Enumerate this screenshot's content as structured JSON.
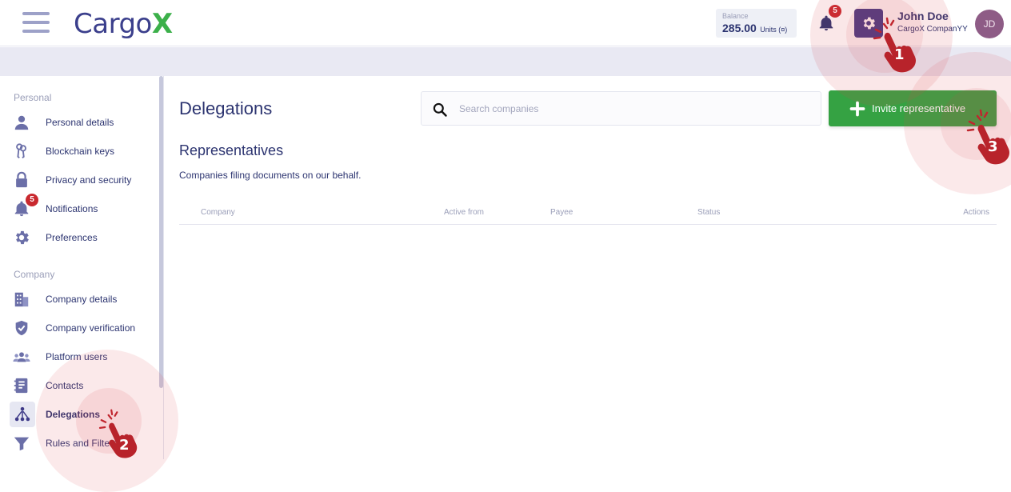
{
  "header": {
    "logo_main": "Cargo",
    "logo_x": "X",
    "balance_label": "Balance",
    "balance_value": "285.00",
    "balance_units": "Units (¤)",
    "notification_count": "5",
    "user_name": "John Doe",
    "user_company": "CargoX CompanYY",
    "avatar_initials": "JD"
  },
  "sidebar": {
    "personal_title": "Personal",
    "personal_items": [
      {
        "label": "Personal details",
        "icon": "person-icon"
      },
      {
        "label": "Blockchain keys",
        "icon": "keys-icon"
      },
      {
        "label": "Privacy and security",
        "icon": "lock-icon"
      },
      {
        "label": "Notifications",
        "icon": "bell-icon",
        "badge": "5"
      },
      {
        "label": "Preferences",
        "icon": "gear-icon"
      }
    ],
    "company_title": "Company",
    "company_items": [
      {
        "label": "Company details",
        "icon": "building-icon"
      },
      {
        "label": "Company verification",
        "icon": "shield-check-icon"
      },
      {
        "label": "Platform users",
        "icon": "users-icon"
      },
      {
        "label": "Contacts",
        "icon": "contacts-book-icon"
      },
      {
        "label": "Delegations",
        "icon": "delegation-tree-icon",
        "active": true
      },
      {
        "label": "Rules and Filters",
        "icon": "filter-icon"
      }
    ]
  },
  "main": {
    "title": "Delegations",
    "search_placeholder": "Search companies",
    "search_value": "",
    "invite_label": "Invite representative",
    "section_title": "Representatives",
    "section_desc": "Companies filing documents on our behalf.",
    "columns": [
      "Company",
      "Active from",
      "Payee",
      "Status",
      "Actions"
    ]
  },
  "annotations": {
    "steps": [
      "1",
      "2",
      "3"
    ]
  },
  "colors": {
    "primary": "#2c3470",
    "accent_purple": "#3e3a88",
    "green": "#35a243",
    "badge_red": "#c9292f",
    "annotation_red": "#c0262e"
  }
}
